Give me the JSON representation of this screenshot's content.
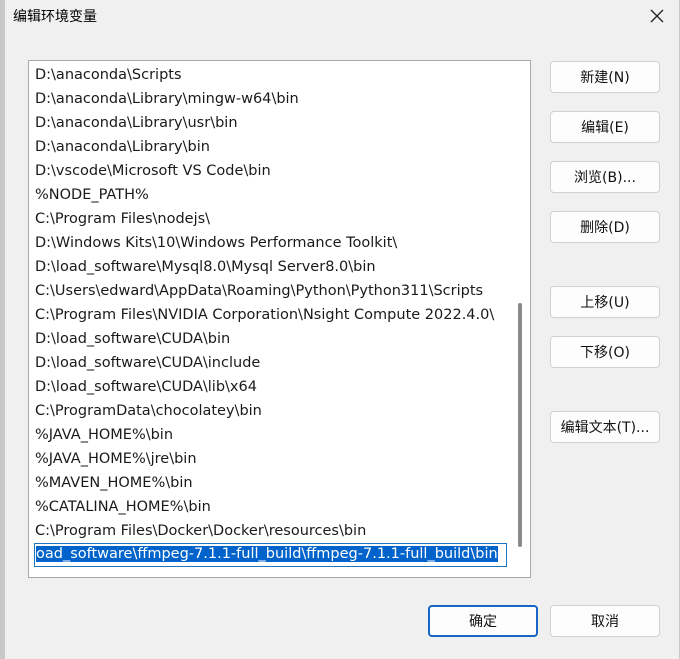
{
  "window": {
    "title": "编辑环境变量",
    "close_label": "✕"
  },
  "path_list": {
    "items": [
      "D:\\anaconda\\Scripts",
      "D:\\anaconda\\Library\\mingw-w64\\bin",
      "D:\\anaconda\\Library\\usr\\bin",
      "D:\\anaconda\\Library\\bin",
      "D:\\vscode\\Microsoft VS Code\\bin",
      "%NODE_PATH%",
      "C:\\Program Files\\nodejs\\",
      "D:\\Windows Kits\\10\\Windows Performance Toolkit\\",
      "D:\\load_software\\Mysql8.0\\Mysql Server8.0\\bin",
      "C:\\Users\\edward\\AppData\\Roaming\\Python\\Python311\\Scripts",
      "C:\\Program Files\\NVIDIA Corporation\\Nsight Compute 2022.4.0\\",
      "D:\\load_software\\CUDA\\bin",
      "D:\\load_software\\CUDA\\include",
      "D:\\load_software\\CUDA\\lib\\x64",
      "C:\\ProgramData\\chocolatey\\bin",
      "%JAVA_HOME%\\bin",
      "%JAVA_HOME%\\jre\\bin",
      "%MAVEN_HOME%\\bin",
      "%CATALINA_HOME%\\bin",
      "C:\\Program Files\\Docker\\Docker\\resources\\bin"
    ],
    "editing_value": "oad_software\\ffmpeg-7.1.1-full_build\\ffmpeg-7.1.1-full_build\\bin"
  },
  "buttons": {
    "new": "新建(N)",
    "edit": "编辑(E)",
    "browse": "浏览(B)...",
    "delete": "删除(D)",
    "move_up": "上移(U)",
    "move_down": "下移(O)",
    "edit_text": "编辑文本(T)...",
    "ok": "确定",
    "cancel": "取消"
  },
  "colors": {
    "selection": "#0063cc",
    "default_button_border": "#1667c5"
  }
}
